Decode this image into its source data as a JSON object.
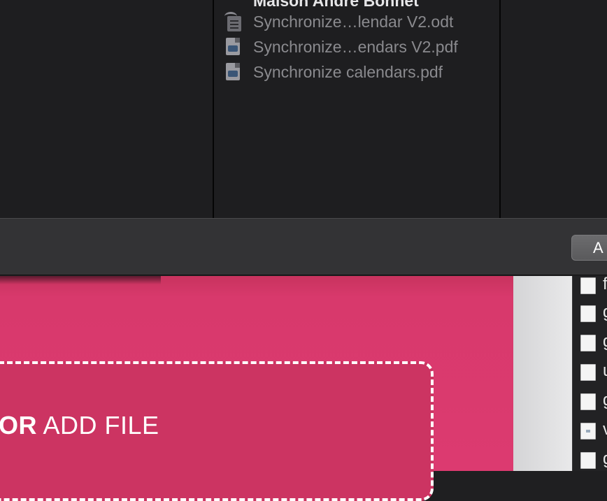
{
  "finder": {
    "files": [
      {
        "name": "Maison André Bonnet",
        "icon": "folder-icon"
      },
      {
        "name": "Synchronize…lendar V2.odt",
        "icon": "odt-document-icon"
      },
      {
        "name": "Synchronize…endars V2.pdf",
        "icon": "pdf-document-icon"
      },
      {
        "name": "Synchronize calendars.pdf",
        "icon": "pdf-document-icon"
      }
    ]
  },
  "toolbar": {
    "button_label": "A"
  },
  "upload": {
    "or_label": "OR",
    "add_file_label": "ADD FILE"
  },
  "side_list": {
    "items": [
      "f",
      "g",
      "g",
      "u",
      "g",
      "v",
      "g"
    ]
  },
  "colors": {
    "accent_pink": "#dc3a70",
    "window_dark": "#1f1f21",
    "toolbar": "#333335"
  }
}
